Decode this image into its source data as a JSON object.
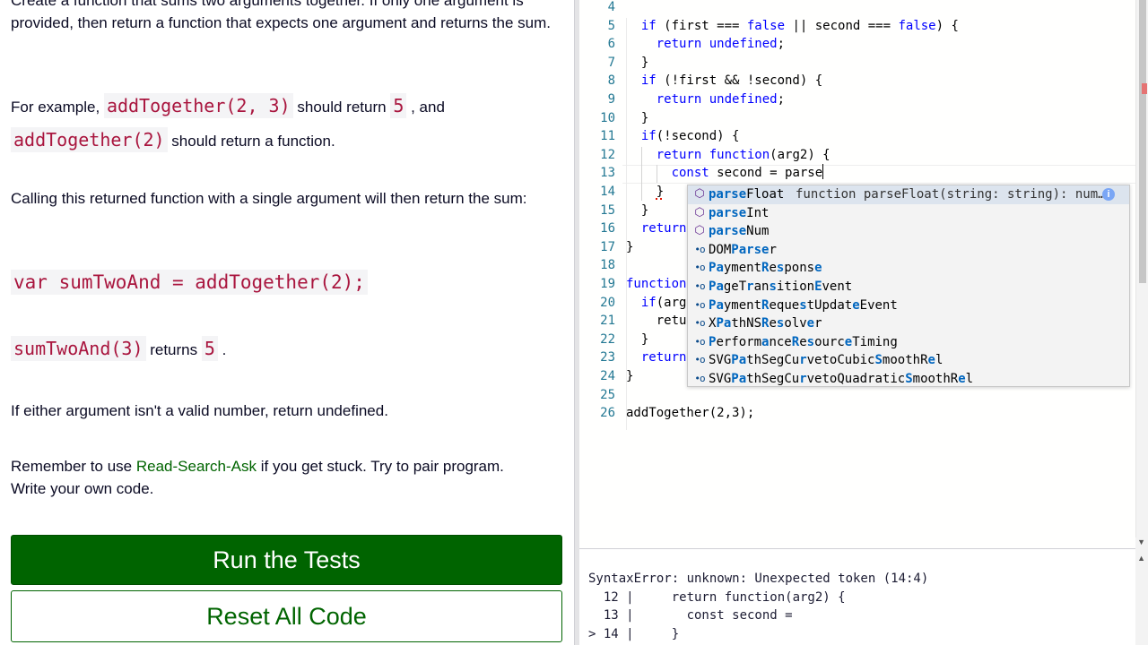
{
  "instructions": {
    "p1": "Create a function that sums two arguments together. If only one argument is provided, then return a function that expects one argument and returns the sum.",
    "p2_prefix": "For example, ",
    "p2_code1": "addTogether(2, 3)",
    "p2_mid": " should return ",
    "p2_code2": "5",
    "p2_after": " , and",
    "p2_code3": "addTogether(2)",
    "p2_suffix": " should return a function.",
    "p3": "Calling this returned function with a single argument will then return the sum:",
    "example_code": "var sumTwoAnd = addTogether(2);",
    "p4_code1": "sumTwoAnd(3)",
    "p4_mid": " returns ",
    "p4_code2": "5",
    "p4_suffix": " .",
    "p5": "If either argument isn't a valid number, return undefined.",
    "p6_prefix": "Remember to use ",
    "p6_link": "Read-Search-Ask",
    "p6_suffix": " if you get stuck. Try to pair program.",
    "p7": "Write your own code."
  },
  "buttons": {
    "run": "Run the Tests",
    "reset": "Reset All Code"
  },
  "editor": {
    "lines": [
      {
        "n": "4",
        "t": ""
      },
      {
        "n": "5",
        "t": "  if (first === false || second === false) {"
      },
      {
        "n": "6",
        "t": "    return undefined;"
      },
      {
        "n": "7",
        "t": "  }"
      },
      {
        "n": "8",
        "t": "  if (!first && !second) {"
      },
      {
        "n": "9",
        "t": "    return undefined;"
      },
      {
        "n": "10",
        "t": "  }"
      },
      {
        "n": "11",
        "t": "  if(!second) {"
      },
      {
        "n": "12",
        "t": "    return function(arg2) {"
      },
      {
        "n": "13",
        "t": "      const second = parse"
      },
      {
        "n": "14",
        "t": "    }"
      },
      {
        "n": "15",
        "t": "  }"
      },
      {
        "n": "16",
        "t": "  return"
      },
      {
        "n": "17",
        "t": "}"
      },
      {
        "n": "18",
        "t": ""
      },
      {
        "n": "19",
        "t": "function"
      },
      {
        "n": "20",
        "t": "  if(arg"
      },
      {
        "n": "21",
        "t": "    retu"
      },
      {
        "n": "22",
        "t": "  }"
      },
      {
        "n": "23",
        "t": "  return"
      },
      {
        "n": "24",
        "t": "}"
      },
      {
        "n": "25",
        "t": ""
      },
      {
        "n": "26",
        "t": "addTogether(2,3);"
      }
    ]
  },
  "suggestions": {
    "detail": "function parseFloat(string: string): num…",
    "info_glyph": "i",
    "items": [
      {
        "icon": "⬡",
        "label": "parseFloat",
        "kind": "fn"
      },
      {
        "icon": "⬡",
        "label": "parseInt",
        "kind": "fn"
      },
      {
        "icon": "⬡",
        "label": "parseNum",
        "kind": "fn"
      },
      {
        "icon": "•o",
        "label": "DOMParser",
        "kind": "cls"
      },
      {
        "icon": "•o",
        "label": "PaymentResponse",
        "kind": "cls"
      },
      {
        "icon": "•o",
        "label": "PageTransitionEvent",
        "kind": "cls"
      },
      {
        "icon": "•o",
        "label": "PaymentRequestUpdateEvent",
        "kind": "cls"
      },
      {
        "icon": "•o",
        "label": "XPathNSResolver",
        "kind": "cls"
      },
      {
        "icon": "•o",
        "label": "PerformanceResourceTiming",
        "kind": "cls"
      },
      {
        "icon": "•o",
        "label": "SVGPathSegCurvetoCubicSmoothRel",
        "kind": "cls"
      },
      {
        "icon": "•o",
        "label": "SVGPathSegCurvetoQuadraticSmoothRel",
        "kind": "cls"
      }
    ]
  },
  "console": {
    "lines": [
      "SyntaxError: unknown: Unexpected token (14:4)",
      "  12 |     return function(arg2) {",
      "  13 |       const second =",
      "> 14 |     }"
    ]
  },
  "colors": {
    "accent_green": "#006400",
    "inline_code": "#a9153e",
    "keyword": "#0000ff",
    "line_number": "#237893",
    "match_highlight": "#0066bf"
  }
}
